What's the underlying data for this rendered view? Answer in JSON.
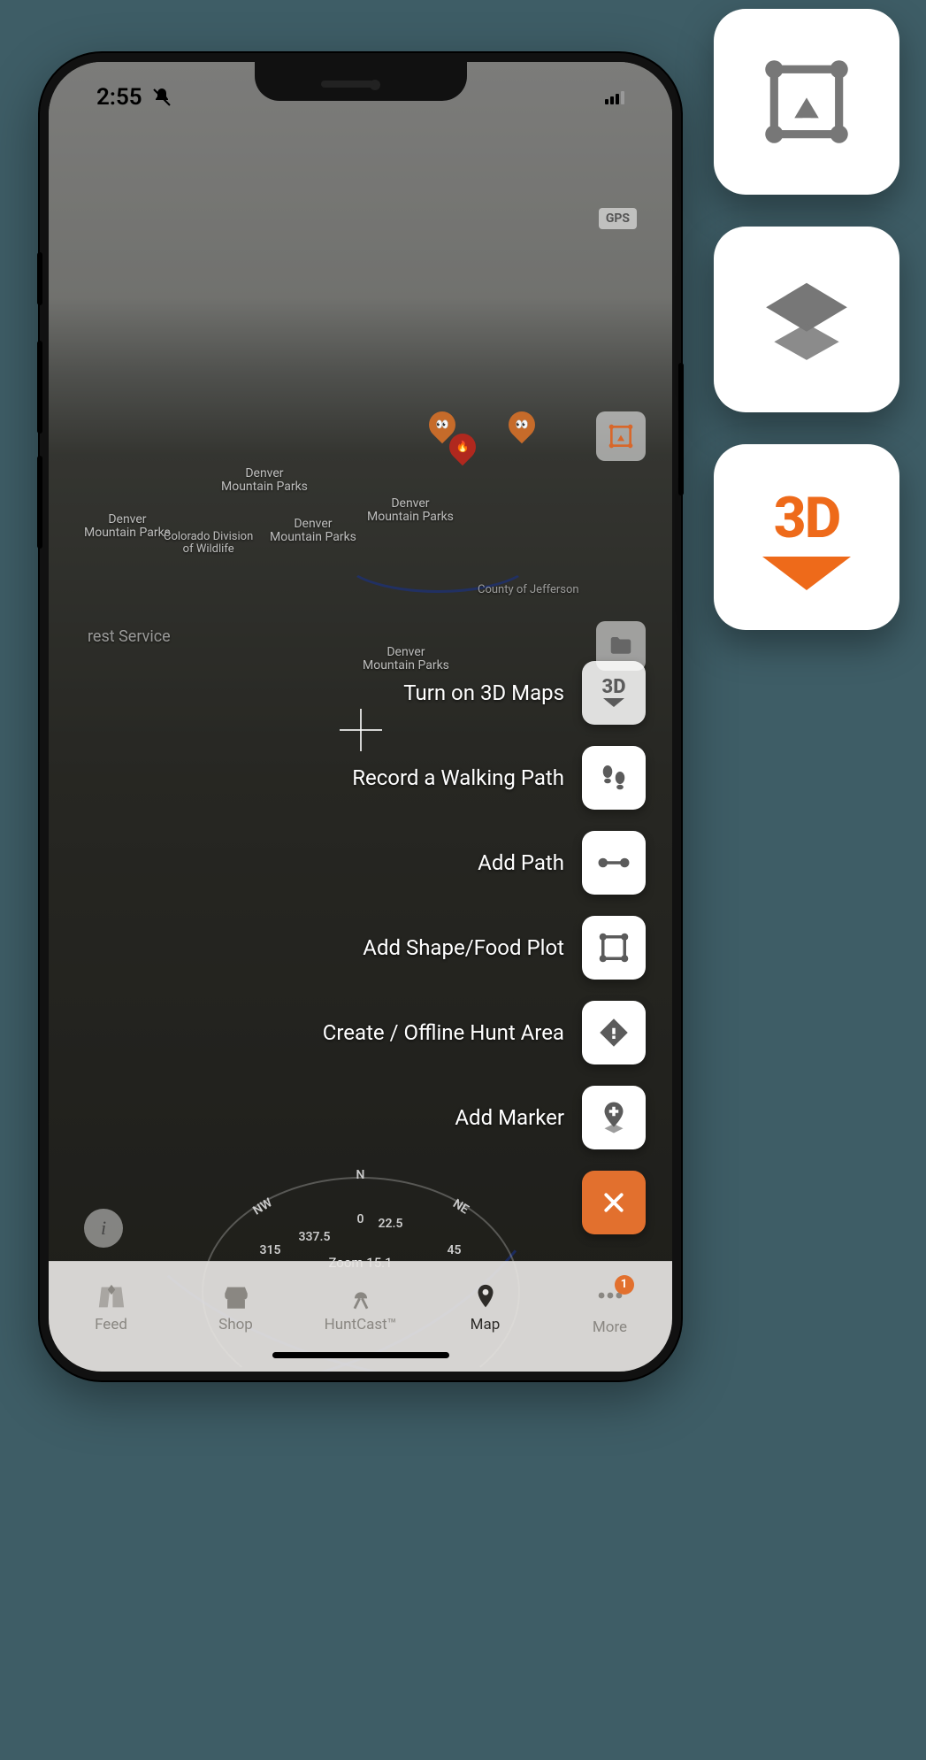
{
  "status": {
    "time": "2:55",
    "silent_icon": "bell-slash-icon"
  },
  "map": {
    "gps_chip": "GPS",
    "zoom_label": "Zoom 15.1",
    "labels": {
      "denver_mp_1": "Denver\nMountain Parks",
      "denver_mp_2": "Denver\nMountain Parks",
      "denver_mp_3": "Denver\nMountain Parks",
      "denver_mp_4": "Denver\nMountain Parks",
      "denver_mp_5": "Denver\nMountain Parks",
      "cdw": "Colorado Division\nof Wildlife",
      "jefferson": "County of Jefferson",
      "forest": "rest Service"
    },
    "compass": {
      "n": "N",
      "nw": "NW",
      "ne": "NE",
      "deg_0": "0",
      "deg_337": "337.5",
      "deg_22": "22.5",
      "deg_315": "315",
      "deg_45": "45"
    }
  },
  "sidebar_peek": {
    "area_icon": "hunt-area-outline-icon",
    "folder_icon": "folder-icon"
  },
  "fab": {
    "items": [
      {
        "label": "Turn on 3D Maps",
        "icon": "3d-maps-icon"
      },
      {
        "label": "Record a Walking Path",
        "icon": "footsteps-icon"
      },
      {
        "label": "Add Path",
        "icon": "path-icon"
      },
      {
        "label": "Add Shape/Food Plot",
        "icon": "shape-icon"
      },
      {
        "label": "Create / Offline Hunt Area",
        "icon": "offline-area-icon"
      },
      {
        "label": "Add Marker",
        "icon": "add-marker-icon"
      }
    ],
    "close_icon": "close-icon"
  },
  "tabs": {
    "feed": "Feed",
    "shop": "Shop",
    "huntcast": "HuntCast™",
    "map": "Map",
    "more": "More",
    "more_badge": "1"
  },
  "callouts": {
    "hunt_area_icon": "hunt-area-icon",
    "layers_icon": "layers-icon",
    "three_d_label": "3D"
  },
  "colors": {
    "accent_orange": "#ee6a1a",
    "fab_orange": "#e2702e",
    "icon_gray": "#777777"
  }
}
